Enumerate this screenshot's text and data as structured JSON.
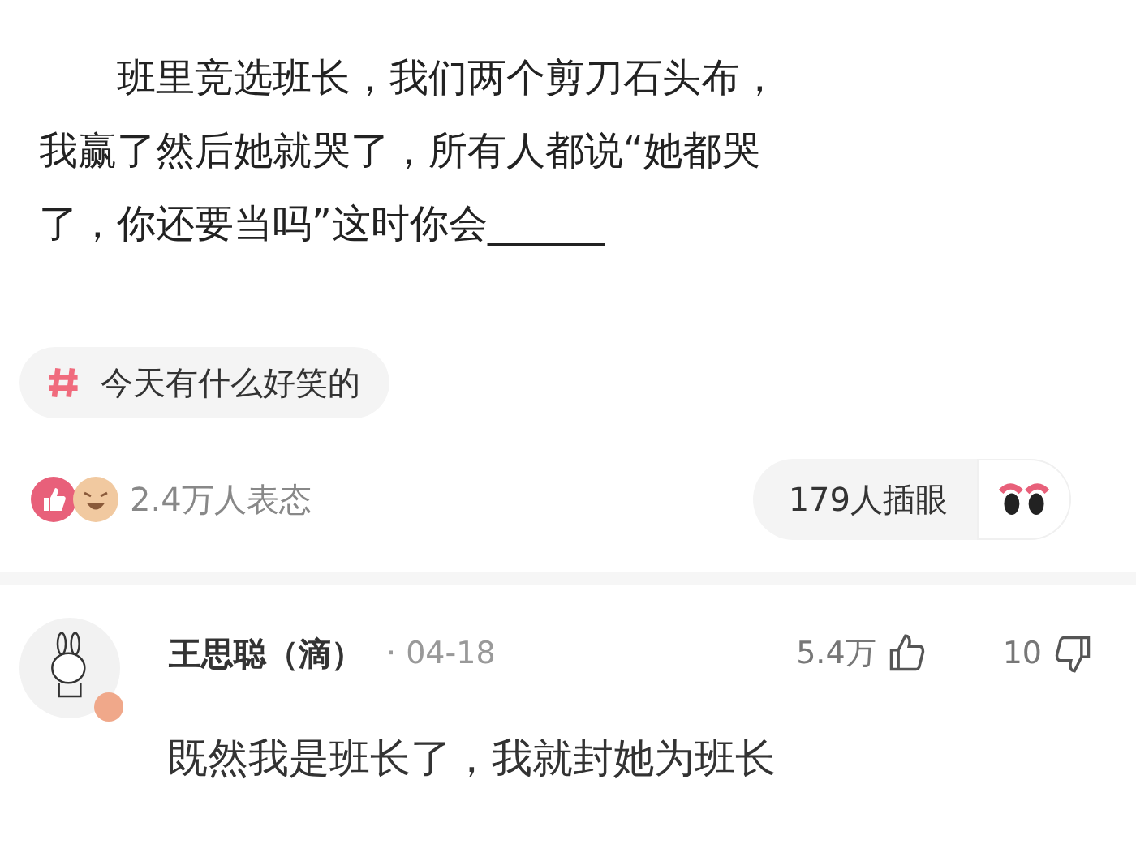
{
  "post": {
    "lines": [
      "班里竞选班长，我们两个剪刀石头布，我赢了然后她就哭了，所有人都说“她都哭了，你还要当吗”这时你会"
    ],
    "blank": "______"
  },
  "topic": {
    "label": "今天有什么好笑的"
  },
  "reactions": {
    "count": "2.4万人表态"
  },
  "watch": {
    "label": "179人插眼"
  },
  "comment": {
    "author": "王思聪（滴）",
    "date": "· 04-18",
    "likes": "5.4万",
    "dislikes": "10",
    "text": "既然我是班长了，我就封她为班长"
  }
}
